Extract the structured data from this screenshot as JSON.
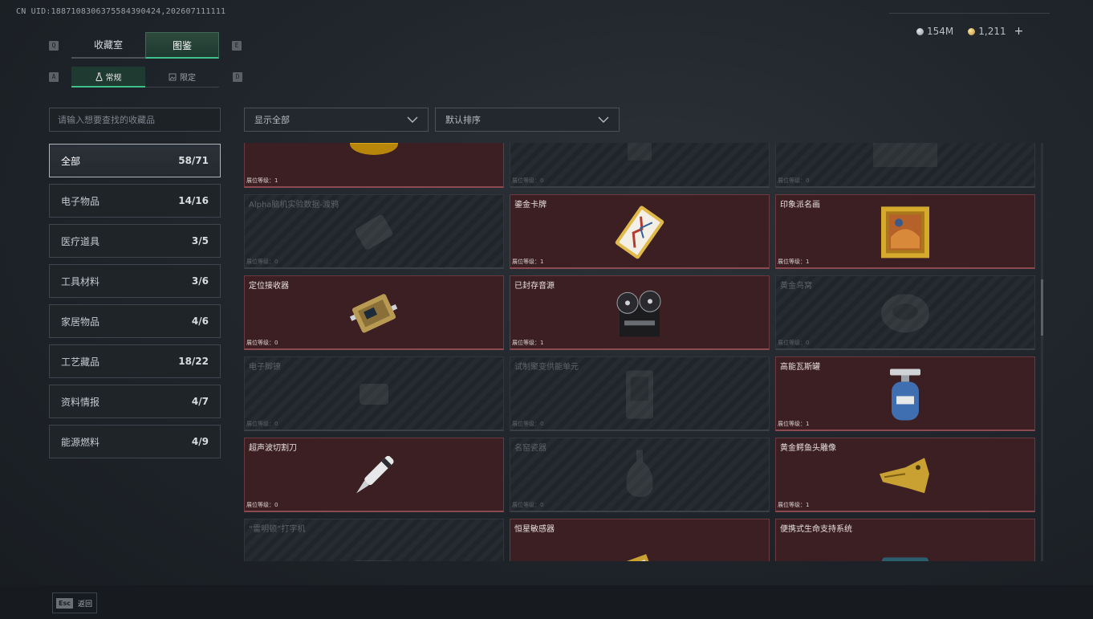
{
  "uid": "CN UID:1887108306375584390424,202607111111",
  "currency": {
    "silver": "154M",
    "gold": "1,211",
    "add_label": "+"
  },
  "key_hints": {
    "tab_prev": "Q",
    "tab_next": "E",
    "sub_prev": "A",
    "sub_next": "D"
  },
  "tabs": [
    {
      "label": "收藏室",
      "active": false
    },
    {
      "label": "图鉴",
      "active": true
    }
  ],
  "subtabs": [
    {
      "label": "常规",
      "active": true
    },
    {
      "label": "限定",
      "active": false
    }
  ],
  "search": {
    "placeholder": "请输入想要查找的收藏品"
  },
  "filters": {
    "show": "显示全部",
    "sort": "默认排序"
  },
  "categories": [
    {
      "label": "全部",
      "count": "58/71",
      "active": true
    },
    {
      "label": "电子物品",
      "count": "14/16"
    },
    {
      "label": "医疗道具",
      "count": "3/5"
    },
    {
      "label": "工具材料",
      "count": "3/6"
    },
    {
      "label": "家居物品",
      "count": "4/6"
    },
    {
      "label": "工艺藏品",
      "count": "18/22"
    },
    {
      "label": "资料情报",
      "count": "4/7"
    },
    {
      "label": "能源燃料",
      "count": "4/9"
    }
  ],
  "items": [
    {
      "name": "",
      "level": "展位等级：1",
      "owned": true,
      "icon": "caviar-tin-icon"
    },
    {
      "name": "",
      "level": "展位等级：0",
      "owned": false,
      "icon": "unknown-item-icon"
    },
    {
      "name": "",
      "level": "展位等级：0",
      "owned": false,
      "icon": "unknown-item-icon"
    },
    {
      "name": "Alpha脑机实验数据-渡鸦",
      "level": "展位等级：0",
      "owned": false,
      "icon": "data-drive-icon"
    },
    {
      "name": "鎏金卡牌",
      "level": "展位等级：1",
      "owned": true,
      "icon": "gilded-card-icon"
    },
    {
      "name": "印象派名画",
      "level": "展位等级：1",
      "owned": true,
      "icon": "framed-painting-icon"
    },
    {
      "name": "定位接收器",
      "level": "展位等级：0",
      "owned": true,
      "icon": "receiver-icon"
    },
    {
      "name": "已封存音源",
      "level": "展位等级：1",
      "owned": true,
      "icon": "reel-recorder-icon"
    },
    {
      "name": "黄金鸟窝",
      "level": "展位等级：0",
      "owned": false,
      "icon": "bird-nest-icon"
    },
    {
      "name": "电子脚镣",
      "level": "展位等级：0",
      "owned": false,
      "icon": "ankle-monitor-icon"
    },
    {
      "name": "试制聚变供能单元",
      "level": "展位等级：0",
      "owned": false,
      "icon": "fusion-cell-icon"
    },
    {
      "name": "高能瓦斯罐",
      "level": "展位等级：1",
      "owned": true,
      "icon": "gas-canister-icon"
    },
    {
      "name": "超声波切割刀",
      "level": "展位等级：0",
      "owned": true,
      "icon": "ultrasonic-cutter-icon"
    },
    {
      "name": "名窑瓷器",
      "level": "展位等级：0",
      "owned": false,
      "icon": "porcelain-vase-icon"
    },
    {
      "name": "黄金鳄鱼头雕像",
      "level": "展位等级：1",
      "owned": true,
      "icon": "gold-crocodile-icon"
    },
    {
      "name": "“雷明顿”打字机",
      "level": "",
      "owned": false,
      "icon": "typewriter-icon"
    },
    {
      "name": "恒星敏感器",
      "level": "",
      "owned": true,
      "icon": "star-sensor-icon"
    },
    {
      "name": "便携式生命支持系统",
      "level": "",
      "owned": true,
      "icon": "life-support-icon"
    }
  ],
  "footer": {
    "esc": "Esc",
    "back_label": "返回"
  }
}
